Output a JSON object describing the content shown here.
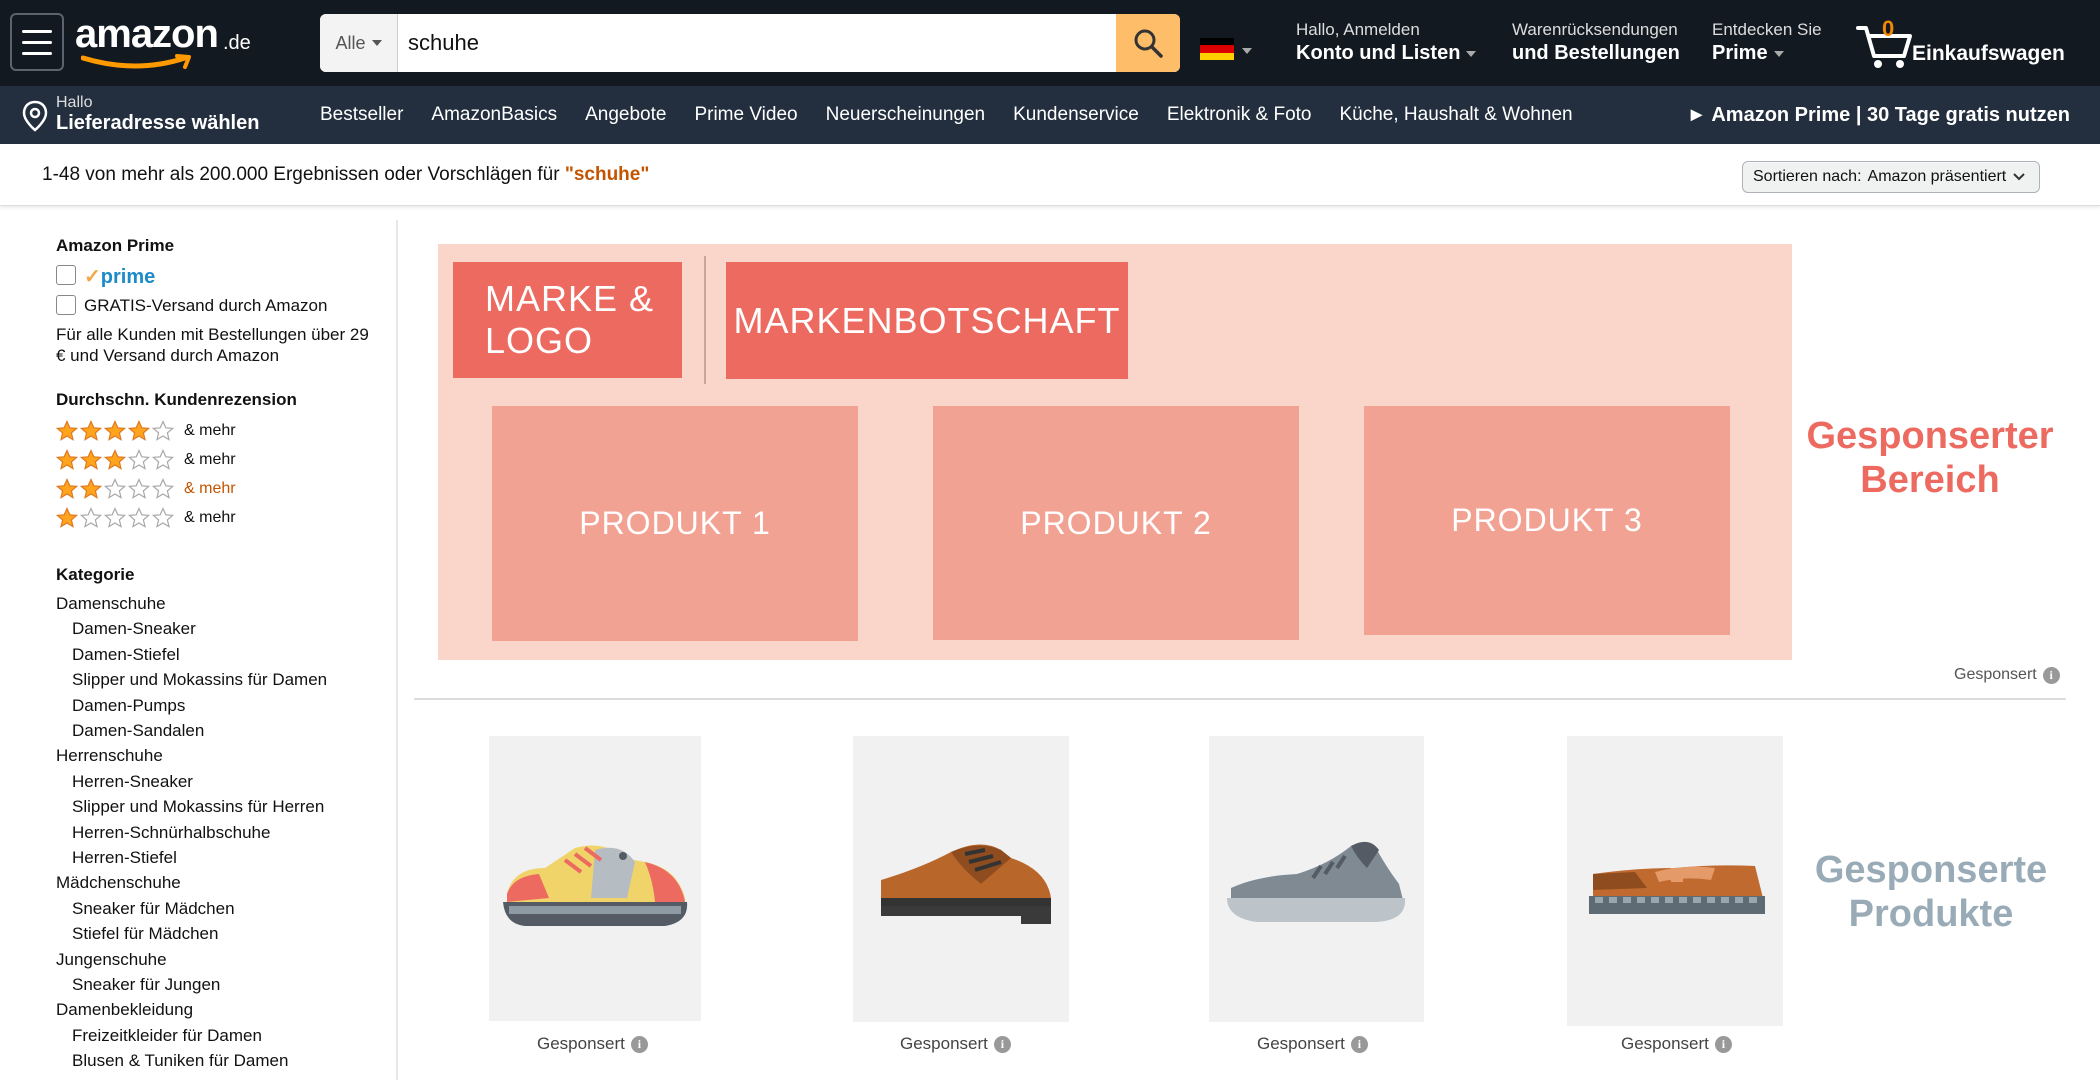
{
  "header": {
    "logo_text": "amazon",
    "logo_tld": ".de",
    "search": {
      "category": "Alle",
      "query": "schuhe"
    },
    "account": {
      "line1": "Hallo, Anmelden",
      "line2": "Konto und Listen"
    },
    "returns": {
      "line1": "Warenrücksendungen",
      "line2": "und Bestellungen"
    },
    "prime": {
      "line1": "Entdecken Sie",
      "line2": "Prime"
    },
    "cart": {
      "count": "0",
      "label": "Einkaufswagen"
    }
  },
  "subnav": {
    "address": {
      "line1": "Hallo",
      "line2": "Lieferadresse wählen"
    },
    "links": [
      "Bestseller",
      "AmazonBasics",
      "Angebote",
      "Prime Video",
      "Neuerscheinungen",
      "Kundenservice",
      "Elektronik & Foto",
      "Küche, Haushalt & Wohnen"
    ],
    "promo": "► Amazon Prime | 30 Tage gratis nutzen"
  },
  "results": {
    "summary": "1-48 von mehr als 200.000 Ergebnissen oder Vorschlägen für ",
    "query_quoted": "\"schuhe\"",
    "sort_label": "Sortieren nach:",
    "sort_value": "Amazon präsentiert"
  },
  "sidebar": {
    "prime_heading": "Amazon Prime",
    "prime_logo": "prime",
    "free_shipping": "GRATIS-Versand durch Amazon",
    "free_shipping_note_1": "Für alle Kunden mit Bestellungen über 29",
    "free_shipping_note_2": "€ und Versand durch Amazon",
    "reviews_heading": "Durchschn. Kundenrezension",
    "ratings": [
      {
        "stars": 4,
        "label": "& mehr"
      },
      {
        "stars": 3,
        "label": "& mehr"
      },
      {
        "stars": 2,
        "label": "& mehr"
      },
      {
        "stars": 1,
        "label": "& mehr"
      }
    ],
    "category_heading": "Kategorie",
    "categories": [
      {
        "label": "Damenschuhe",
        "level": 0
      },
      {
        "label": "Damen-Sneaker",
        "level": 1
      },
      {
        "label": "Damen-Stiefel",
        "level": 1
      },
      {
        "label": "Slipper und Mokassins für Damen",
        "level": 1
      },
      {
        "label": "Damen-Pumps",
        "level": 1
      },
      {
        "label": "Damen-Sandalen",
        "level": 1
      },
      {
        "label": "Herrenschuhe",
        "level": 0
      },
      {
        "label": "Herren-Sneaker",
        "level": 1
      },
      {
        "label": "Slipper und Mokassins für Herren",
        "level": 1
      },
      {
        "label": "Herren-Schnürhalbschuhe",
        "level": 1
      },
      {
        "label": "Herren-Stiefel",
        "level": 1
      },
      {
        "label": "Mädchenschuhe",
        "level": 0
      },
      {
        "label": "Sneaker für Mädchen",
        "level": 1
      },
      {
        "label": "Stiefel für Mädchen",
        "level": 1
      },
      {
        "label": "Jungenschuhe",
        "level": 0
      },
      {
        "label": "Sneaker für Jungen",
        "level": 1
      },
      {
        "label": "Damenbekleidung",
        "level": 0
      },
      {
        "label": "Freizeitkleider für Damen",
        "level": 1
      },
      {
        "label": "Blusen & Tuniken für Damen",
        "level": 1
      }
    ]
  },
  "banner": {
    "brand_logo": "MARKE & LOGO",
    "brand_message": "MARKENBOTSCHAFT",
    "products": [
      "PRODUKT 1",
      "PRODUKT 2",
      "PRODUKT 3"
    ],
    "area_label_1": "Gesponserter",
    "area_label_2": "Bereich",
    "sponsored": "Gesponsert"
  },
  "sponsored_products": {
    "items": [
      {
        "icon": "sneaker-icon",
        "label": "Gesponsert"
      },
      {
        "icon": "oxford-shoe-icon",
        "label": "Gesponsert"
      },
      {
        "icon": "running-shoe-icon",
        "label": "Gesponsert"
      },
      {
        "icon": "loafer-icon",
        "label": "Gesponsert"
      }
    ],
    "area_label_1": "Gesponserte",
    "area_label_2": "Produkte"
  },
  "colors": {
    "nav_dark": "#131921",
    "nav_sub": "#232f3e",
    "search_button": "#febd69",
    "banner_bg": "#fad6ca",
    "brand_block": "#ec6a60",
    "product_block": "#f2a293",
    "link_orange": "#c45500",
    "sponsored_products_label": "#9aabb8"
  }
}
